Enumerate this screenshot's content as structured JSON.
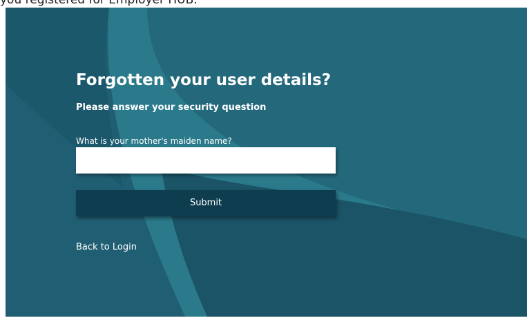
{
  "top_strip": {
    "text": "you registered for Employer HUB."
  },
  "form": {
    "heading": "Forgotten your user details?",
    "subheading": "Please answer your security question",
    "question_label": "What is your mother's maiden name?",
    "answer_value": "",
    "submit_label": "Submit",
    "back_link_label": "Back to Login"
  },
  "colors": {
    "panel_background": "#205f73",
    "panel_light_shape": "#2b7a8b",
    "panel_dark_shape": "#1a5466",
    "submit_button": "#0e3d50",
    "text": "#ffffff"
  }
}
